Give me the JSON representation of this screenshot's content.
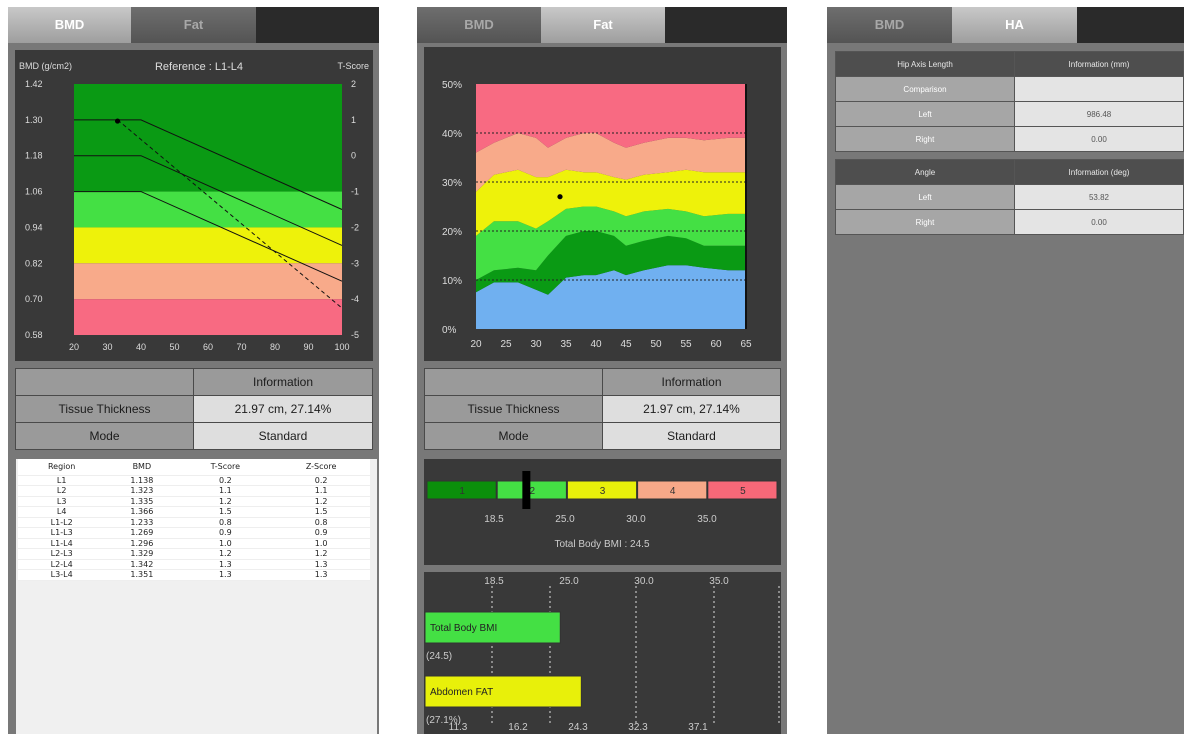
{
  "bmd_panel": {
    "tabs": [
      "BMD",
      "Fat"
    ],
    "active_tab": "BMD",
    "chart_labels": {
      "title": "Reference : L1-L4",
      "ylabel": "BMD (g/cm2)",
      "y2label": "T-Score",
      "yticks": [
        "1.42",
        "1.30",
        "1.18",
        "1.06",
        "0.94",
        "0.82",
        "0.70",
        "0.58"
      ],
      "y2ticks": [
        "2",
        "1",
        "0",
        "-1",
        "-2",
        "-3",
        "-4",
        "-5"
      ],
      "xticks": [
        "20",
        "30",
        "40",
        "50",
        "60",
        "70",
        "80",
        "90",
        "100"
      ]
    },
    "info_table": {
      "header": "Information",
      "rows": [
        {
          "label": "Tissue Thickness",
          "value": "21.97 cm, 27.14%"
        },
        {
          "label": "Mode",
          "value": "Standard"
        }
      ]
    },
    "region_table": {
      "headers": [
        "Region",
        "BMD",
        "T-Score",
        "Z-Score"
      ],
      "rows": [
        [
          "L1",
          "1.138",
          "0.2",
          "0.2"
        ],
        [
          "L2",
          "1.323",
          "1.1",
          "1.1"
        ],
        [
          "L3",
          "1.335",
          "1.2",
          "1.2"
        ],
        [
          "L4",
          "1.366",
          "1.5",
          "1.5"
        ],
        [
          "L1-L2",
          "1.233",
          "0.8",
          "0.8"
        ],
        [
          "L1-L3",
          "1.269",
          "0.9",
          "0.9"
        ],
        [
          "L1-L4",
          "1.296",
          "1.0",
          "1.0"
        ],
        [
          "L2-L3",
          "1.329",
          "1.2",
          "1.2"
        ],
        [
          "L2-L4",
          "1.342",
          "1.3",
          "1.3"
        ],
        [
          "L3-L4",
          "1.351",
          "1.3",
          "1.3"
        ]
      ]
    }
  },
  "fat_panel": {
    "tabs": [
      "BMD",
      "Fat"
    ],
    "active_tab": "Fat",
    "chart_labels": {
      "yticks": [
        "50%",
        "40%",
        "30%",
        "20%",
        "10%",
        "0%"
      ],
      "xticks": [
        "20",
        "25",
        "30",
        "35",
        "40",
        "45",
        "50",
        "55",
        "60",
        "65"
      ]
    },
    "info_table": {
      "header": "Information",
      "rows": [
        {
          "label": "Tissue Thickness",
          "value": "21.97 cm, 27.14%"
        },
        {
          "label": "Mode",
          "value": "Standard"
        }
      ]
    },
    "bmi_scale": {
      "segments": [
        "1",
        "2",
        "3",
        "4",
        "5"
      ],
      "segment_colors": [
        "#0b8f0b",
        "#44e044",
        "#e8f00a",
        "#f8a888",
        "#f86878"
      ],
      "ticks": [
        "18.5",
        "25.0",
        "30.0",
        "35.0"
      ],
      "marker_value": 24.5,
      "caption": "Total Body BMI : 24.5"
    },
    "bars": {
      "top_ticks": [
        "18.5",
        "25.0",
        "30.0",
        "35.0"
      ],
      "bottom_ticks": [
        "11.3",
        "16.2",
        "24.3",
        "32.3",
        "37.1"
      ],
      "items": [
        {
          "label": "Total Body BMI",
          "value_text": "(24.5)",
          "color": "#44e044"
        },
        {
          "label": "Abdomen FAT",
          "value_text": "(27.1%)",
          "color": "#e8f00a"
        }
      ]
    }
  },
  "ha_panel": {
    "tabs": [
      "BMD",
      "HA"
    ],
    "active_tab": "HA",
    "length_table": {
      "headers": [
        "Hip Axis Length",
        "Information (mm)"
      ],
      "rows": [
        [
          "Comparison",
          ""
        ],
        [
          "Left",
          "986.48"
        ],
        [
          "Right",
          "0.00"
        ]
      ]
    },
    "angle_table": {
      "headers": [
        "Angle",
        "Information (deg)"
      ],
      "rows": [
        [
          "Left",
          "53.82"
        ],
        [
          "Right",
          "0.00"
        ]
      ]
    }
  },
  "chart_data": [
    {
      "type": "line",
      "title": "Reference : L1-L4",
      "ylabel": "BMD (g/cm2)",
      "y2label": "T-Score",
      "xlim": [
        20,
        100
      ],
      "ylim": [
        0.58,
        1.42
      ],
      "y2lim": [
        -5,
        2
      ],
      "bands": [
        {
          "from": 1.06,
          "to": 1.42,
          "color": "#0a9a14"
        },
        {
          "from": 0.94,
          "to": 1.06,
          "color": "#44e044"
        },
        {
          "from": 0.82,
          "to": 0.94,
          "color": "#eef20a"
        },
        {
          "from": 0.7,
          "to": 0.82,
          "color": "#f8aa8a"
        },
        {
          "from": 0.58,
          "to": 0.7,
          "color": "#f86a82"
        }
      ],
      "series": [
        {
          "style": "solid",
          "x": [
            20,
            40,
            100
          ],
          "y": [
            1.3,
            1.3,
            1.0
          ]
        },
        {
          "style": "solid",
          "x": [
            20,
            40,
            100
          ],
          "y": [
            1.18,
            1.18,
            0.88
          ]
        },
        {
          "style": "solid",
          "x": [
            20,
            40,
            100
          ],
          "y": [
            1.06,
            1.06,
            0.76
          ]
        },
        {
          "style": "dashed",
          "x": [
            33,
            100
          ],
          "y": [
            1.3,
            0.67
          ]
        }
      ],
      "points": [
        {
          "x": 33,
          "y": 1.296
        }
      ]
    },
    {
      "type": "area",
      "xlim": [
        20,
        65
      ],
      "ylim": [
        0,
        50
      ],
      "x": [
        20,
        23,
        27,
        30,
        32,
        35,
        38,
        40,
        43,
        45,
        48,
        52,
        55,
        58,
        62,
        64
      ],
      "band_colors": [
        "#70b0f0",
        "#0a9a14",
        "#44e044",
        "#eef20a",
        "#f8aa8a",
        "#f86a82"
      ],
      "boundaries": [
        [
          7.5,
          9.5,
          9.5,
          8,
          7,
          10.5,
          11,
          11,
          12,
          11,
          12,
          13,
          13,
          12.5,
          12,
          12
        ],
        [
          10,
          12,
          12.5,
          12,
          15,
          19,
          20,
          20,
          19,
          17,
          18,
          19,
          18.5,
          17,
          17,
          17
        ],
        [
          19,
          22,
          22,
          20.5,
          22,
          24.5,
          25,
          25,
          24,
          23,
          24,
          24.5,
          24,
          23,
          23.5,
          23.5
        ],
        [
          28,
          31.5,
          32.5,
          31,
          31,
          32.5,
          32,
          32,
          31,
          30.5,
          31.5,
          32,
          32.5,
          32,
          32,
          32
        ],
        [
          36,
          38,
          40,
          39,
          37,
          39,
          40,
          40,
          38,
          37,
          38,
          39,
          39,
          38.5,
          39,
          39
        ],
        [
          50,
          50,
          50,
          50,
          50,
          50,
          50,
          50,
          50,
          50,
          50,
          50,
          50,
          50,
          50,
          50
        ]
      ],
      "gridlines_y": [
        10,
        20,
        30,
        40
      ],
      "points": [
        {
          "x": 34,
          "y": 27
        }
      ]
    },
    {
      "type": "bar",
      "orientation": "horizontal",
      "categories": [
        "Total Body BMI",
        "Abdomen FAT"
      ],
      "values": [
        24.5,
        27.1
      ],
      "value_labels": [
        "(24.5)",
        "(27.1%)"
      ]
    }
  ]
}
